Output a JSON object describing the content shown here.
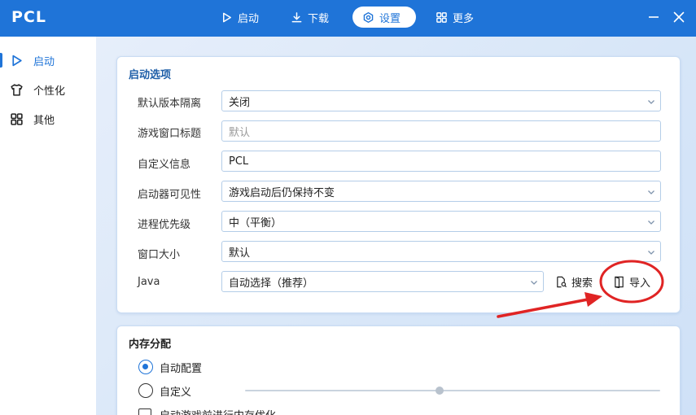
{
  "app": {
    "title": "PCL"
  },
  "nav": [
    {
      "label": "启动",
      "icon": "play-icon"
    },
    {
      "label": "下载",
      "icon": "download-icon"
    },
    {
      "label": "设置",
      "icon": "gear-icon",
      "active": true
    },
    {
      "label": "更多",
      "icon": "grid-icon"
    }
  ],
  "sidebar": {
    "items": [
      {
        "label": "启动",
        "icon": "play-icon",
        "active": true
      },
      {
        "label": "个性化",
        "icon": "shirt-icon"
      },
      {
        "label": "其他",
        "icon": "grid-icon"
      }
    ]
  },
  "launch_options": {
    "title": "启动选项",
    "rows": [
      {
        "label": "默认版本隔离",
        "value": "关闭",
        "type": "select"
      },
      {
        "label": "游戏窗口标题",
        "placeholder": "默认",
        "type": "input"
      },
      {
        "label": "自定义信息",
        "value": "PCL",
        "type": "input"
      },
      {
        "label": "启动器可见性",
        "value": "游戏启动后仍保持不变",
        "type": "select"
      },
      {
        "label": "进程优先级",
        "value": "中（平衡）",
        "type": "select"
      },
      {
        "label": "窗口大小",
        "value": "默认",
        "type": "select"
      },
      {
        "label": "Java",
        "value": "自动选择（推荐）",
        "type": "select"
      }
    ],
    "search_label": "搜索",
    "import_label": "导入"
  },
  "memory": {
    "title": "内存分配",
    "auto_label": "自动配置",
    "custom_label": "自定义",
    "selected": "auto",
    "optimize_label": "启动游戏前进行内存优化",
    "slider_level": 0.46
  },
  "colors": {
    "accent": "#1f74d8",
    "annotation": "#e02424"
  }
}
